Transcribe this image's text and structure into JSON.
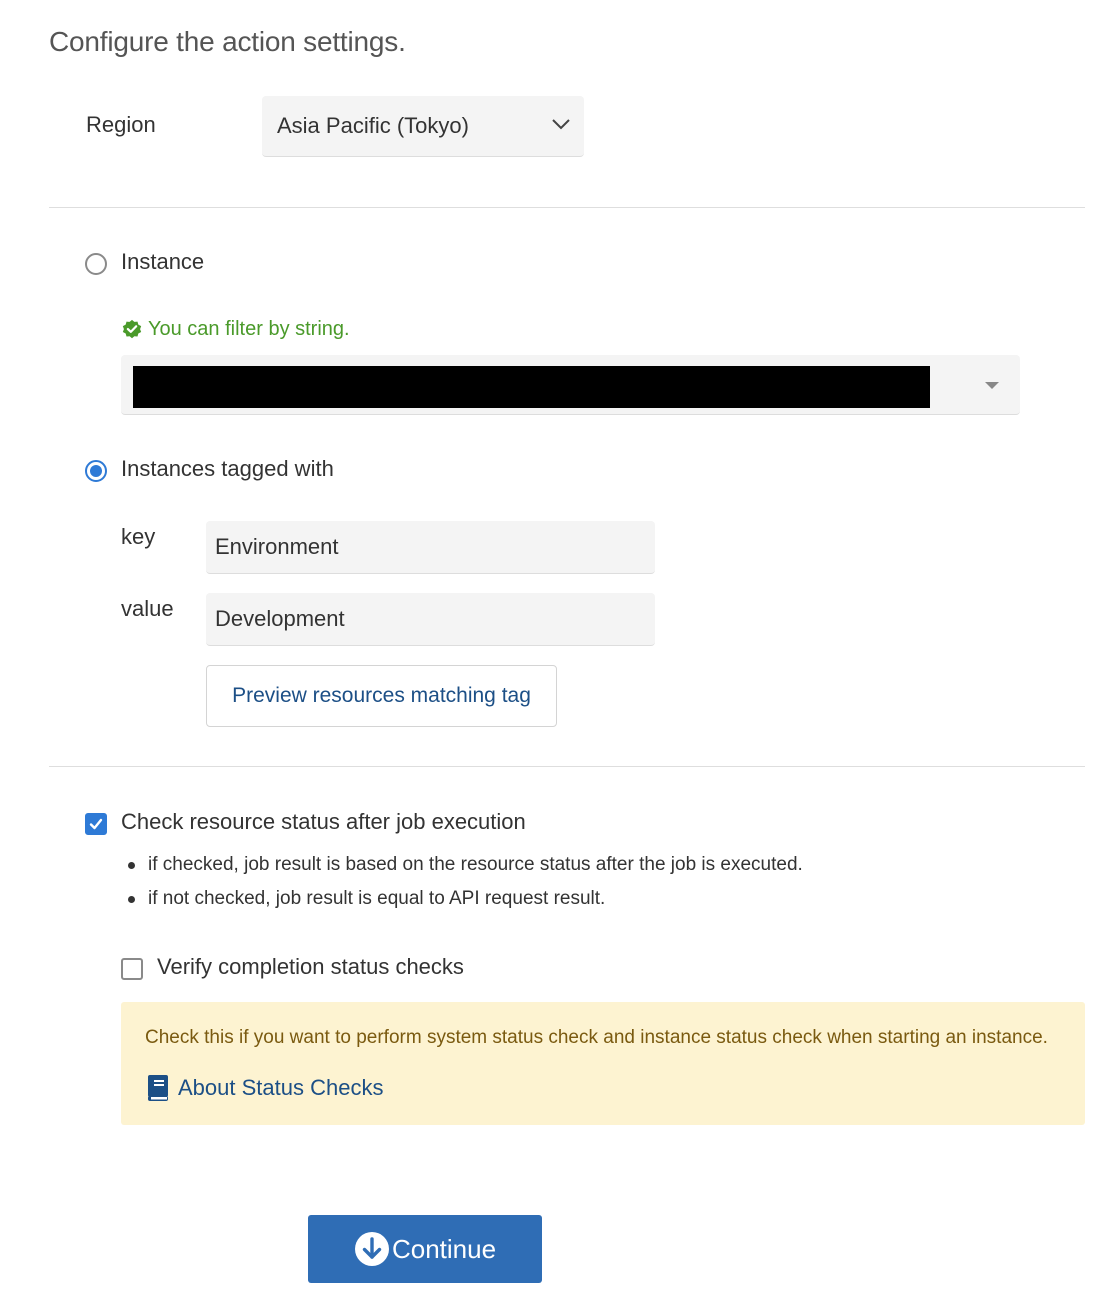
{
  "page": {
    "title": "Configure the action settings."
  },
  "region": {
    "label": "Region",
    "selected": "Asia Pacific (Tokyo)"
  },
  "target": {
    "instance_option": {
      "label": "Instance",
      "checked": false
    },
    "filter_hint": "You can filter by string.",
    "tagged_option": {
      "label": "Instances tagged with",
      "checked": true
    },
    "key": {
      "label": "key",
      "value": "Environment"
    },
    "value": {
      "label": "value",
      "value": "Development"
    },
    "preview_button": "Preview resources matching tag"
  },
  "status_check": {
    "label": "Check resource status after job execution",
    "checked": true,
    "notes": [
      "if checked, job result is based on the resource status after the job is executed.",
      "if not checked, job result is equal to API request result."
    ]
  },
  "verify": {
    "label": "Verify completion status checks",
    "checked": false,
    "note": "Check this if you want to perform system status check and instance status check when starting an instance.",
    "link": "About Status Checks"
  },
  "actions": {
    "continue": "Continue"
  },
  "colors": {
    "accent": "#2e7ad6",
    "button": "#2f6db5",
    "hint": "#4a9a2a",
    "note_bg": "#fdf3d1"
  }
}
